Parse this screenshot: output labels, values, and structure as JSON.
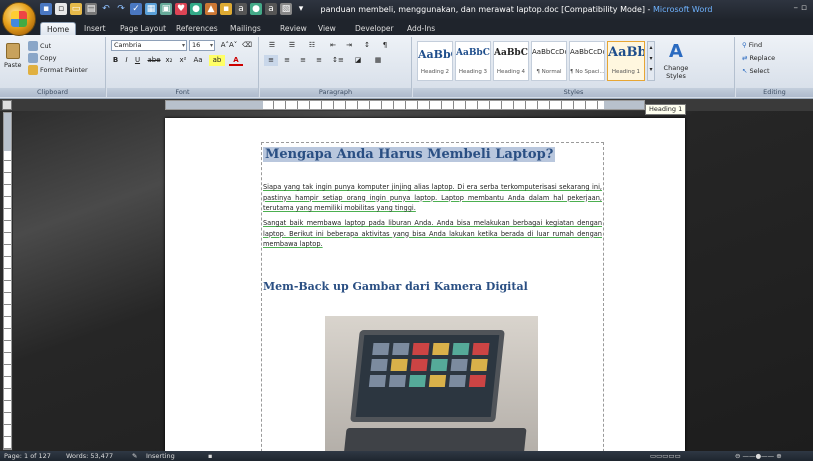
{
  "window": {
    "title": "panduan membeli, menggunakan, dan merawat laptop.doc [Compatibility Mode]",
    "title_sep": " - ",
    "app_name": "Microsoft Word"
  },
  "tabs": [
    "Home",
    "Insert",
    "Page Layout",
    "References",
    "Mailings",
    "Review",
    "View",
    "Developer",
    "Add-Ins"
  ],
  "ribbon": {
    "clipboard": {
      "label": "Clipboard",
      "paste": "Paste",
      "cut": "Cut",
      "copy": "Copy",
      "format_painter": "Format Painter"
    },
    "font": {
      "label": "Font",
      "font_name": "Cambria",
      "font_size": "16",
      "bold": "B",
      "italic": "I",
      "underline": "U",
      "strike": "abe",
      "subscript": "x₂",
      "superscript": "x²",
      "change_case": "Aa"
    },
    "paragraph": {
      "label": "Paragraph"
    },
    "styles": {
      "label": "Styles",
      "items": [
        {
          "sample": "AaBbC(",
          "name": "Heading 2"
        },
        {
          "sample": "AaBbCcI",
          "name": "Heading 3"
        },
        {
          "sample": "AaBbCcI",
          "name": "Heading 4"
        },
        {
          "sample": "AaBbCcDc",
          "name": "¶ Normal"
        },
        {
          "sample": "AaBbCcDc",
          "name": "¶ No Spaci..."
        },
        {
          "sample": "AaBb(",
          "name": "Heading 1"
        }
      ],
      "change_styles": "Change Styles"
    },
    "editing": {
      "label": "Editing",
      "find": "Find",
      "replace": "Replace",
      "select": "Select"
    }
  },
  "tooltip": "Heading 1",
  "document": {
    "heading1": "Mengapa Anda Harus Membeli  Laptop?",
    "para1": "Siapa yang tak ingin punya komputer jinjing alias laptop. Di era serba terkomputerisasi sekarang ini, pastinya hampir setiap orang ingin punya laptop. Laptop membantu Anda dalam hal pekerjaan, terutama yang memiliki mobilitas yang tinggi.",
    "para2": "Sangat baik membawa laptop pada liburan Anda. Anda bisa melakukan berbagai kegiatan dengan laptop. Berikut ini beberapa aktivitas yang bisa Anda lakukan ketika berada di luar rumah dengan membawa laptop.",
    "heading2": "Mem-Back up Gambar dari Kamera Digital"
  },
  "status": {
    "page": "Page: 1 of 127",
    "words": "Words: 53,477",
    "mode": "Inserting"
  },
  "colors": {
    "heading": "#2a4f83",
    "app_title": "#6fb3ff",
    "ribbon_bg": "#dfe6ef"
  }
}
